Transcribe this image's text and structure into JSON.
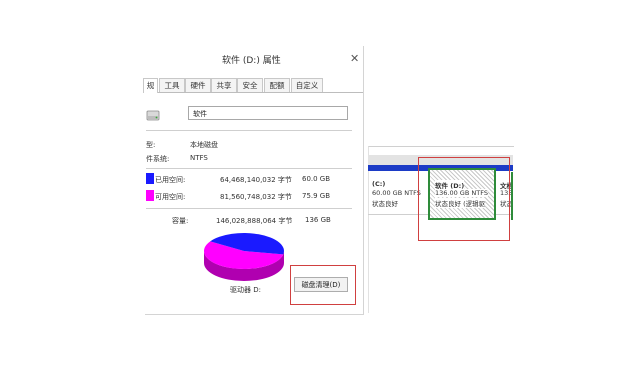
{
  "dialog": {
    "title": "软件 (D:) 属性",
    "close_glyph": "✕",
    "tabs": [
      {
        "label": "规"
      },
      {
        "label": "工具"
      },
      {
        "label": "硬件"
      },
      {
        "label": "共享"
      },
      {
        "label": "安全"
      },
      {
        "label": "配额"
      },
      {
        "label": "自定义"
      }
    ],
    "drive_name": "软件",
    "type_label": "型:",
    "type_value": "本地磁盘",
    "fs_label": "件系统:",
    "fs_value": "NTFS",
    "used": {
      "label": "已用空间:",
      "bytes": "64,468,140,032 字节",
      "size": "60.0 GB",
      "color": "#1a1aff"
    },
    "free": {
      "label": "可用空间:",
      "bytes": "81,560,748,032 字节",
      "size": "75.9 GB",
      "color": "#ff00ff"
    },
    "capacity": {
      "label": "容量:",
      "bytes": "146,028,888,064 字节",
      "size": "136 GB"
    },
    "used_fraction": 0.44,
    "drive_label": "驱动器 D:",
    "cleanup_button": "磁盘清理(D)"
  },
  "disk_management": {
    "partitions": [
      {
        "name": "(C:)",
        "size": "60.00 GB NTFS",
        "status": "状态良好"
      },
      {
        "name": "软件 (D:)",
        "size": "136.00 GB NTFS",
        "status": "状态良好 (逻辑驱"
      },
      {
        "name": "文档",
        "size": "135.",
        "status": "状态"
      }
    ],
    "bar_color": "#1c3bc6",
    "selected_border_color": "#2e8b3a"
  },
  "highlight_color": "#d04040"
}
